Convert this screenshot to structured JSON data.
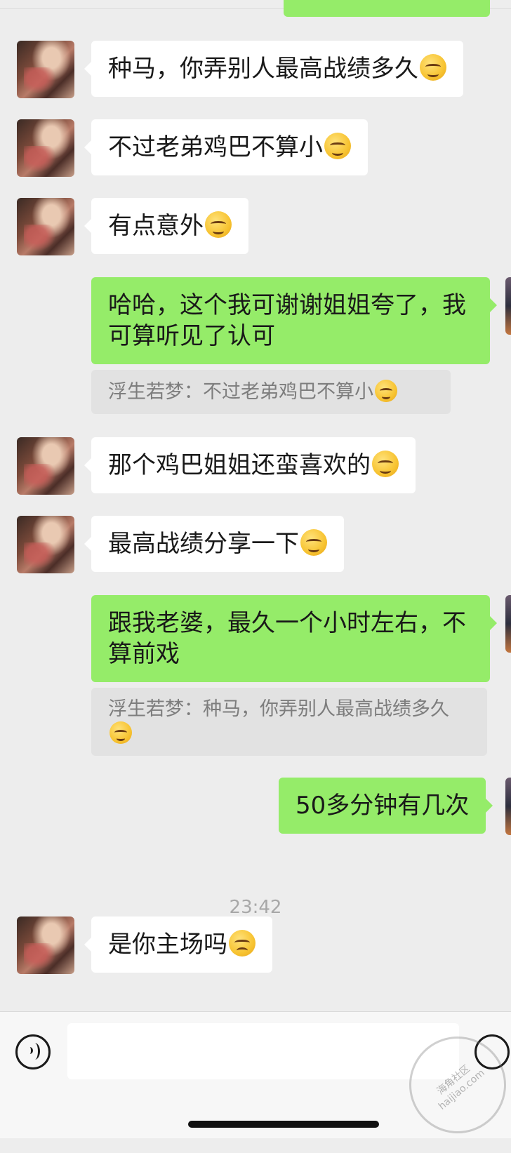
{
  "messages": [
    {
      "side": "left",
      "text": "种马，你弄别人最高战绩多久",
      "emoji": "smirk-emoji"
    },
    {
      "side": "left",
      "text": "不过老弟鸡巴不算小",
      "emoji": "smirk-emoji"
    },
    {
      "side": "left",
      "text": "有点意外",
      "emoji": "smirk-emoji"
    },
    {
      "side": "right",
      "text": "哈哈，这个我可谢谢姐姐夸了，我可算听见了认可",
      "quote": "浮生若梦：不过老弟鸡巴不算小"
    },
    {
      "side": "left",
      "text": "那个鸡巴姐姐还蛮喜欢的",
      "emoji": "smirk-emoji"
    },
    {
      "side": "left",
      "text": "最高战绩分享一下",
      "emoji": "smirk-emoji"
    },
    {
      "side": "right",
      "text": "跟我老婆，最久一个小时左右，不算前戏",
      "quote": "浮生若梦：种马，你弄别人最高战绩多久"
    },
    {
      "side": "right",
      "text": "50多分钟有几次"
    },
    {
      "side": "left",
      "text": "是你主场吗",
      "emoji": "thinking-emoji"
    }
  ],
  "timestamp": "23:42",
  "watermark": {
    "site": "haijiao.com",
    "name": "海角社区"
  }
}
